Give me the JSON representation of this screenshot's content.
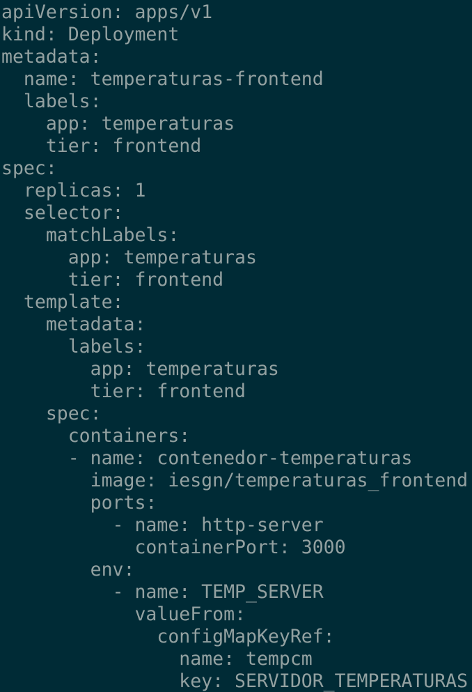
{
  "terminal": {
    "background": "#002b36",
    "text_color": "#93a1a1",
    "lines": [
      "apiVersion: apps/v1",
      "kind: Deployment",
      "metadata:",
      "  name: temperaturas-frontend",
      "  labels:",
      "    app: temperaturas",
      "    tier: frontend",
      "spec:",
      "  replicas: 1",
      "  selector:",
      "    matchLabels:",
      "      app: temperaturas",
      "      tier: frontend",
      "  template:",
      "    metadata:",
      "      labels:",
      "        app: temperaturas",
      "        tier: frontend",
      "    spec:",
      "      containers:",
      "      - name: contenedor-temperaturas",
      "        image: iesgn/temperaturas_frontend",
      "        ports:",
      "          - name: http-server",
      "            containerPort: 3000",
      "        env:",
      "          - name: TEMP_SERVER",
      "            valueFrom:",
      "              configMapKeyRef:",
      "                name: tempcm",
      "                key: SERVIDOR_TEMPERATURAS"
    ]
  }
}
